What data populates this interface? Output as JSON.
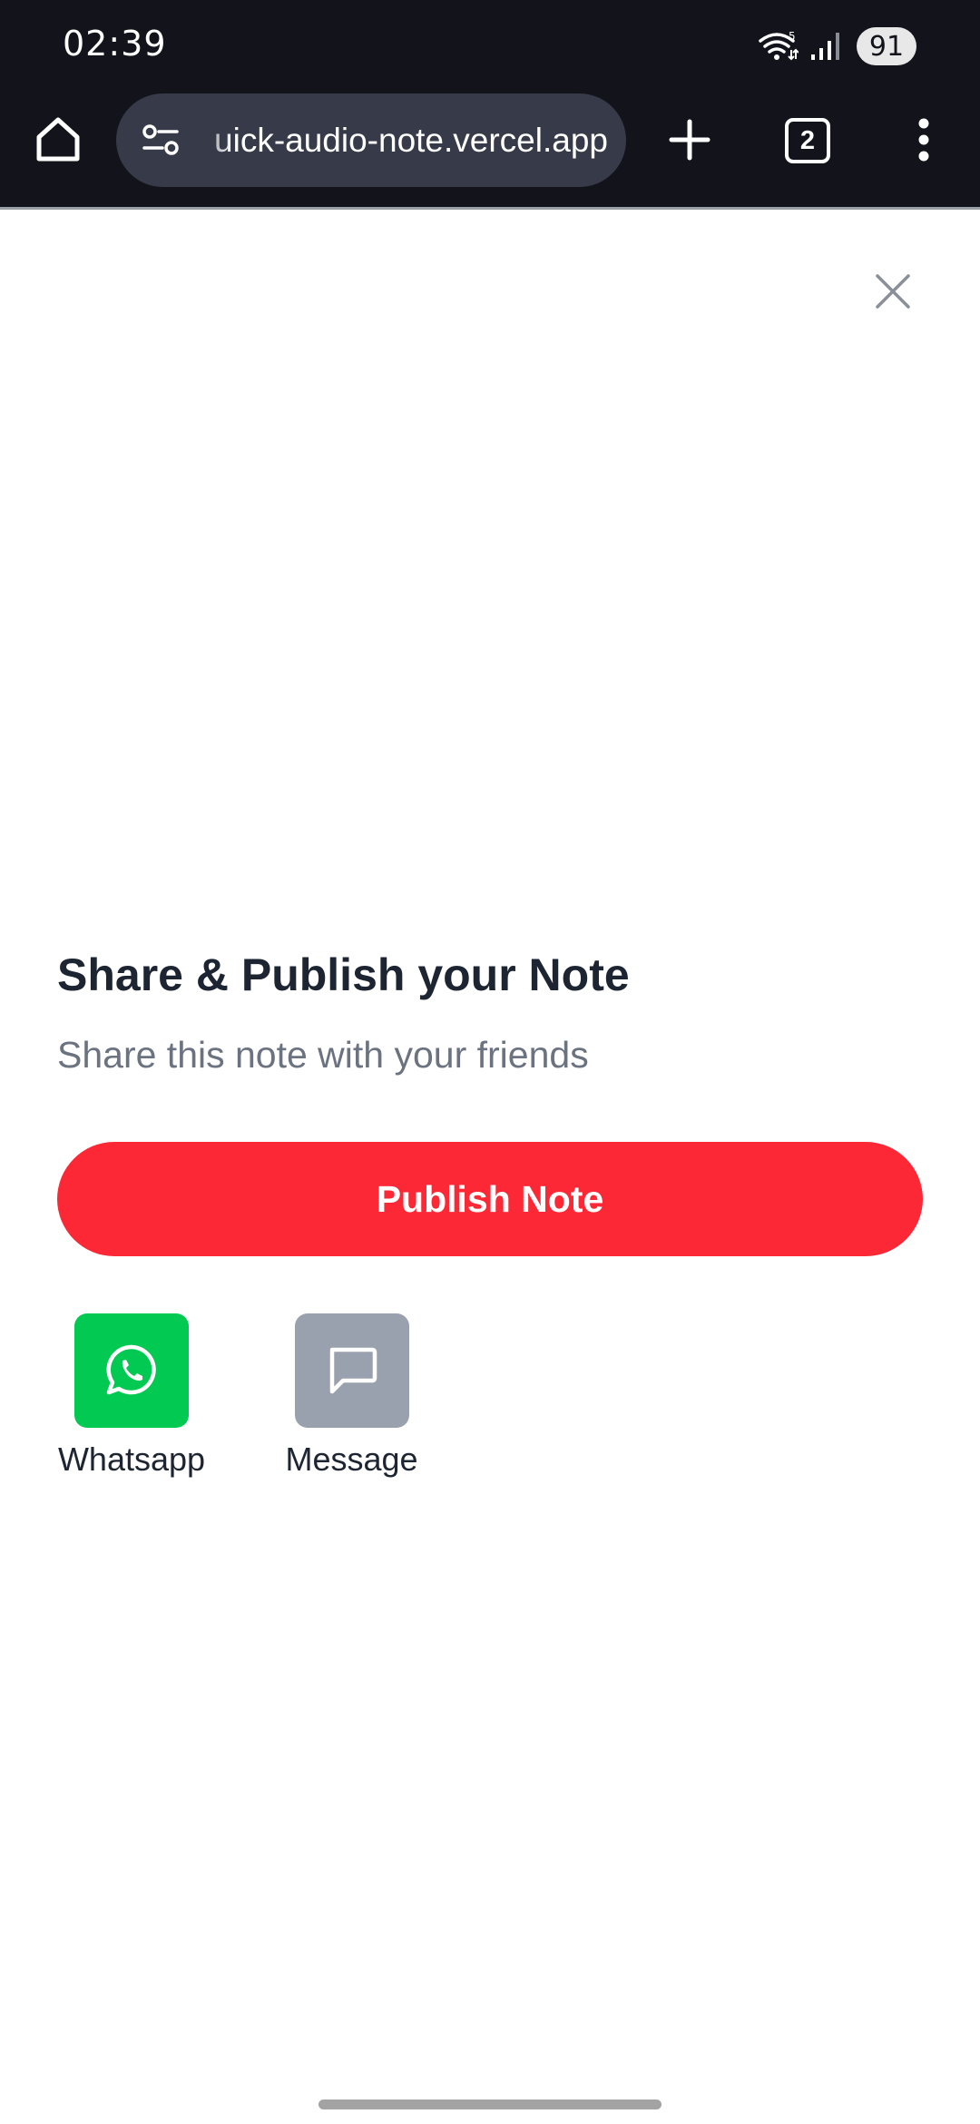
{
  "status_bar": {
    "time": "02:39",
    "wifi_badge": "5",
    "battery": "91",
    "icons": [
      "wifi-icon",
      "signal-icon",
      "battery-icon"
    ]
  },
  "browser": {
    "url": "uick-audio-note.vercel.app",
    "tab_count": "2",
    "icons": [
      "home-icon",
      "site-settings-icon",
      "plus-icon",
      "more-vert-icon"
    ]
  },
  "dialog": {
    "title": "Share & Publish your Note",
    "subtitle": "Share this note with your friends",
    "publish_label": "Publish Note",
    "close_icon": "close-icon",
    "share_options": [
      {
        "label": "Whatsapp",
        "icon": "whatsapp-icon",
        "color": "#02c951"
      },
      {
        "label": "Message",
        "icon": "message-icon",
        "color": "#9aa1ae"
      }
    ]
  },
  "colors": {
    "chrome_bg": "#13141b",
    "url_bar_bg": "#373a48",
    "accent": "#fd2836",
    "title_text": "#1e2532",
    "subtitle_text": "#6b7280"
  }
}
